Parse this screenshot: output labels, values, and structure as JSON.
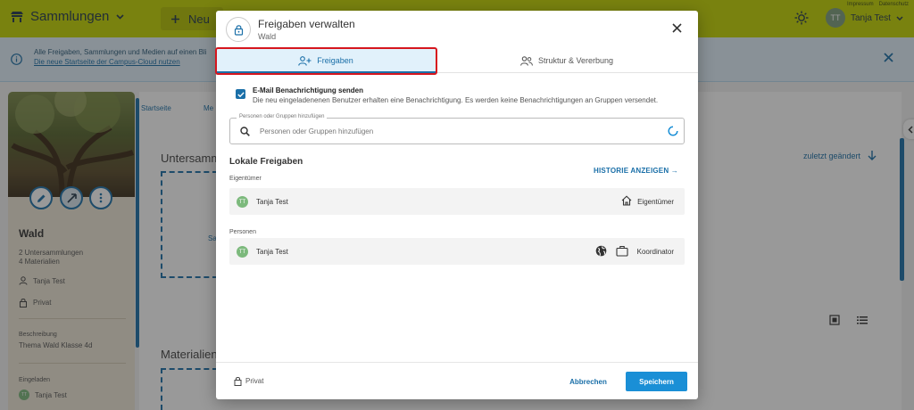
{
  "app": {
    "brand": "Sammlungen",
    "new_label": "Neu",
    "links": [
      "Impressum",
      "Datenschutz"
    ],
    "user_initials": "TT",
    "user_name": "Tanja Test"
  },
  "banner": {
    "line1": "Alle Freigaben, Sammlungen und Medien auf einen Bli",
    "line2": "Die neue Startseite der Campus-Cloud nutzen"
  },
  "background": {
    "collection_title": "Wald",
    "counts": [
      "2 Untersammlungen",
      "4 Materialien"
    ],
    "owner": "Tanja Test",
    "visibility": "Privat",
    "description_label": "Beschreibung",
    "description": "Thema Wald Klasse 4d",
    "invited_label": "Eingeladen",
    "invited_initials": "TT",
    "invited_name": "Tanja Test",
    "breadcrumb_1": "Startseite",
    "breadcrumb_2": "Me",
    "section_sub": "Untersamm",
    "section_mat": "Materialien",
    "dashed_label": "Sa",
    "sort_label": "zuletzt geändert"
  },
  "dialog": {
    "title": "Freigaben verwalten",
    "subtitle": "Wald",
    "tabs": [
      {
        "label": "Freigaben",
        "active": true
      },
      {
        "label": "Struktur & Vererbung",
        "active": false
      }
    ],
    "email_notify": {
      "checked": true,
      "label": "E-Mail Benachrichtigung senden",
      "description": "Die neu eingeladenenen Benutzer erhalten eine Benachrichtigung. Es werden keine Benachrichtigungen an Gruppen versendet."
    },
    "search": {
      "legend": "Personen oder Gruppen hinzufügen",
      "placeholder": "Personen oder Gruppen hinzufügen"
    },
    "local_shares_title": "Lokale Freigaben",
    "history_link": "HISTORIE ANZEIGEN →",
    "owner_group": {
      "label": "Eigentümer",
      "entry": {
        "initials": "TT",
        "name": "Tanja Test",
        "role": "Eigentümer"
      }
    },
    "persons_group": {
      "label": "Personen",
      "entry": {
        "initials": "TT",
        "name": "Tanja Test",
        "role": "Koordinator"
      }
    },
    "footer": {
      "visibility": "Privat",
      "cancel": "Abbrechen",
      "save": "Speichern"
    }
  },
  "colors": {
    "topbar": "#c5d400",
    "accent": "#1a6fa8",
    "save_button": "#1a8fd6",
    "highlight": "#d6161e"
  }
}
